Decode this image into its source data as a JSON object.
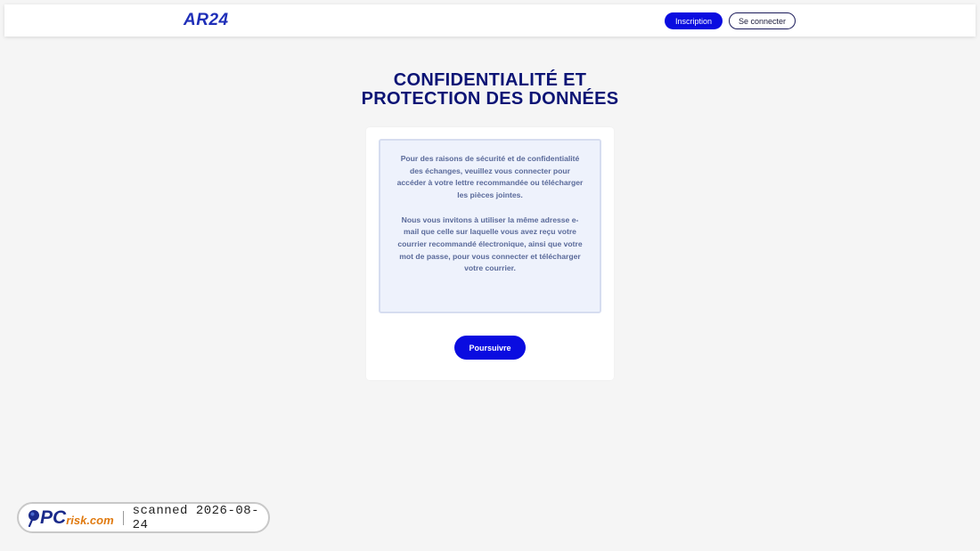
{
  "header": {
    "logo": "AR24",
    "signup_label": "Inscription",
    "login_label": "Se connecter"
  },
  "page": {
    "title_line1": "CONFIDENTIALITÉ ET",
    "title_line2": "PROTECTION DES DONNÉES"
  },
  "info": {
    "paragraph1": "Pour des raisons de sécurité et de confidentialité des échanges, veuillez vous connecter pour accéder à votre lettre recommandée ou télécharger les pièces jointes.",
    "paragraph2": "Nous vous invitons à utiliser la même adresse e-mail que celle sur laquelle vous avez reçu votre courrier recommandé électronique, ainsi que votre mot de passe, pour vous connecter et télécharger votre courrier."
  },
  "actions": {
    "continue_label": "Poursuivre"
  },
  "watermark": {
    "brand_pc": "PC",
    "brand_risk": "risk.com",
    "scan_text": "scanned 2026-08-24"
  },
  "colors": {
    "primary": "#0a0ce0",
    "title": "#0c1475",
    "logo": "#1f2fb8",
    "info_text": "#5a6a9a",
    "info_bg": "#eef2fc"
  }
}
